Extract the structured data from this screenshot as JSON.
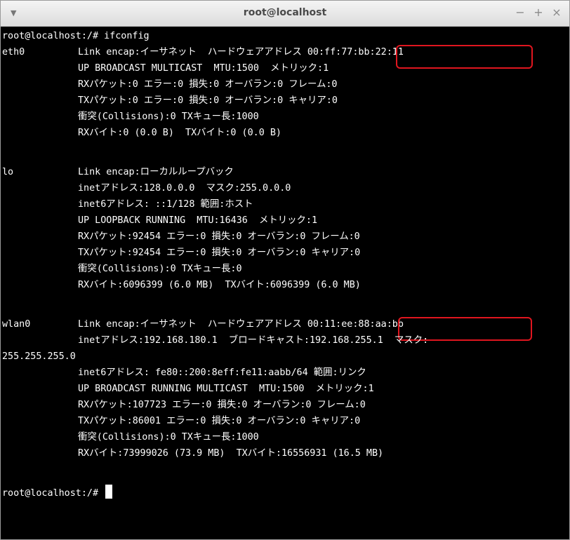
{
  "window": {
    "title": "root@localhost",
    "menu_icon": "chevron-down-icon",
    "buttons": {
      "minimize": "−",
      "maximize": "+",
      "close": "×"
    }
  },
  "terminal": {
    "prompt_command": "root@localhost:/# ifconfig",
    "eth0": {
      "name": "eth0",
      "link_prefix": "Link encap:イーサネット  ハードウェアアドレス",
      "hwaddr": "00:ff:77:bb:22:11",
      "lines": [
        "UP BROADCAST MULTICAST  MTU:1500  メトリック:1",
        "RXパケット:0 エラー:0 損失:0 オーバラン:0 フレーム:0",
        "TXパケット:0 エラー:0 損失:0 オーバラン:0 キャリア:0",
        "衝突(Collisions):0 TXキュー長:1000",
        "RXバイト:0 (0.0 B)  TXバイト:0 (0.0 B)"
      ]
    },
    "lo": {
      "name": "lo",
      "link": "Link encap:ローカルループバック",
      "lines": [
        "inetアドレス:128.0.0.0  マスク:255.0.0.0",
        "inet6アドレス: ::1/128 範囲:ホスト",
        "UP LOOPBACK RUNNING  MTU:16436  メトリック:1",
        "RXパケット:92454 エラー:0 損失:0 オーバラン:0 フレーム:0",
        "TXパケット:92454 エラー:0 損失:0 オーバラン:0 キャリア:0",
        "衝突(Collisions):0 TXキュー長:0",
        "RXバイト:6096399 (6.0 MB)  TXバイト:6096399 (6.0 MB)"
      ]
    },
    "wlan0": {
      "name": "wlan0",
      "link_prefix": "Link encap:イーサネット  ハードウェアアドレス",
      "hwaddr": "00:11:ee:88:aa:bb",
      "inet_line": "inetアドレス:192.168.180.1  ブロードキャスト:192.168.255.1  マスク:",
      "wrap_line": "255.255.255.0",
      "lines": [
        "inet6アドレス: fe80::200:8eff:fe11:aabb/64 範囲:リンク",
        "UP BROADCAST RUNNING MULTICAST  MTU:1500  メトリック:1",
        "RXパケット:107723 エラー:0 損失:0 オーバラン:0 フレーム:0",
        "TXパケット:86001 エラー:0 損失:0 オーバラン:0 キャリア:0",
        "衝突(Collisions):0 TXキュー長:1000",
        "RXバイト:73999026 (73.9 MB)  TXバイト:16556931 (16.5 MB)"
      ]
    },
    "final_prompt": "root@localhost:/# "
  },
  "colors": {
    "highlight_box": "#e0161f",
    "terminal_bg": "#000000",
    "terminal_fg": "#ffffff"
  }
}
